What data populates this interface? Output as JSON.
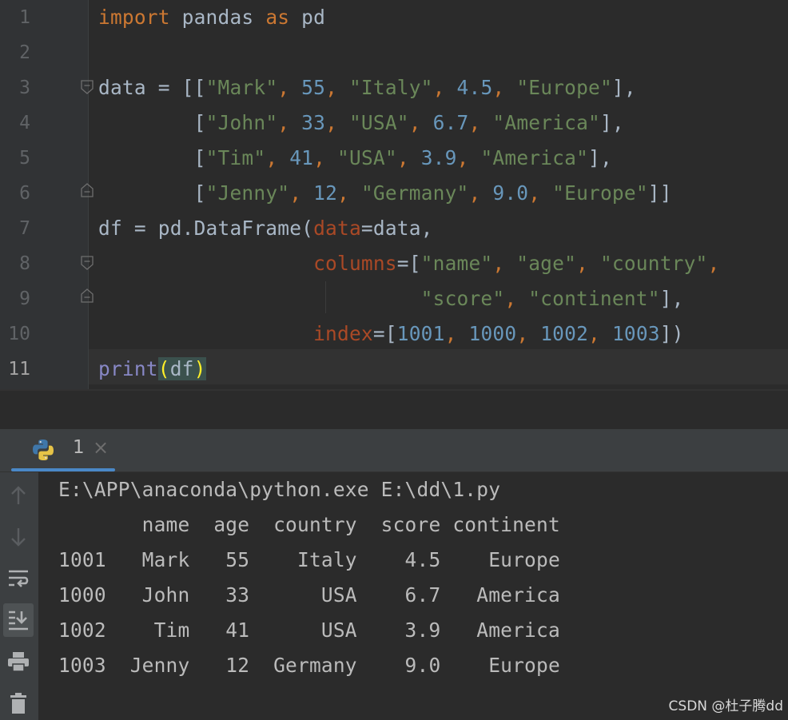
{
  "editor": {
    "line_numbers": [
      "1",
      "2",
      "3",
      "4",
      "5",
      "6",
      "7",
      "8",
      "9",
      "10",
      "11"
    ],
    "current_line": "11",
    "code": {
      "l1": {
        "kw_import": "import",
        "mod": " pandas ",
        "kw_as": "as",
        "alias": " pd"
      },
      "l3": {
        "a": "data = [[",
        "s1": "\"Mark\"",
        "c1": ", ",
        "n1": "55",
        "c2": ", ",
        "s2": "\"Italy\"",
        "c3": ", ",
        "n2": "4.5",
        "c4": ", ",
        "s3": "\"Europe\"",
        "z": "],"
      },
      "l4": {
        "a": "        [",
        "s1": "\"John\"",
        "c1": ", ",
        "n1": "33",
        "c2": ", ",
        "s2": "\"USA\"",
        "c3": ", ",
        "n2": "6.7",
        "c4": ", ",
        "s3": "\"America\"",
        "z": "],"
      },
      "l5": {
        "a": "        [",
        "s1": "\"Tim\"",
        "c1": ", ",
        "n1": "41",
        "c2": ", ",
        "s2": "\"USA\"",
        "c3": ", ",
        "n2": "3.9",
        "c4": ", ",
        "s3": "\"America\"",
        "z": "],"
      },
      "l6": {
        "a": "        [",
        "s1": "\"Jenny\"",
        "c1": ", ",
        "n1": "12",
        "c2": ", ",
        "s2": "\"Germany\"",
        "c3": ", ",
        "n2": "9.0",
        "c4": ", ",
        "s3": "\"Europe\"",
        "z": "]]"
      },
      "l7": {
        "a": "df = pd.DataFrame(",
        "p": "data",
        "b": "=data,"
      },
      "l8": {
        "pad": "                  ",
        "p": "columns",
        "a": "=[",
        "s1": "\"name\"",
        "c1": ", ",
        "s2": "\"age\"",
        "c2": ", ",
        "s3": "\"country\"",
        "z": ","
      },
      "l9": {
        "pad": "                           ",
        "s1": "\"score\"",
        "c1": ", ",
        "s2": "\"continent\"",
        "z": "],"
      },
      "l10": {
        "pad": "                  ",
        "p": "index",
        "a": "=[",
        "n1": "1001",
        "c1": ", ",
        "n2": "1000",
        "c2": ", ",
        "n3": "1002",
        "c3": ", ",
        "n4": "1003",
        "z": "])"
      },
      "l11": {
        "fn": "print",
        "open": "(",
        "arg": "df",
        "close": ")"
      }
    }
  },
  "run_panel": {
    "tab_label": "1",
    "close_glyph": "×",
    "command": "E:\\APP\\anaconda\\python.exe E:\\dd\\1.py",
    "output_header": "       name  age  country  score continent",
    "output_rows": [
      "1001   Mark   55    Italy    4.5    Europe",
      "1000   John   33      USA    6.7   America",
      "1002    Tim   41      USA    3.9   America",
      "1003  Jenny   12  Germany    9.0    Europe"
    ],
    "toolbar_icons": [
      "arrow-up-icon",
      "arrow-down-icon",
      "soft-wrap-icon",
      "scroll-to-end-icon",
      "print-icon",
      "trash-icon"
    ]
  },
  "watermark": "CSDN @杜子腾dd",
  "colors": {
    "background": "#2b2b2b",
    "keyword": "#cc7832",
    "string": "#6a8759",
    "number": "#6897bb",
    "param": "#aa4926",
    "builtin": "#8888c6",
    "accent": "#4a88c7"
  }
}
